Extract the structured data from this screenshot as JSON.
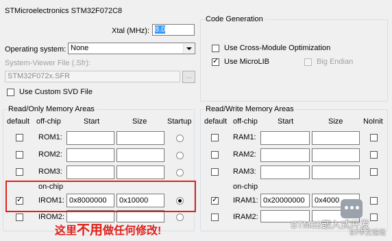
{
  "device": {
    "title": "STMicroelectronics STM32F072C8"
  },
  "xtal": {
    "label": "Xtal (MHz):",
    "value": "8.0"
  },
  "os": {
    "label": "Operating system:",
    "value": "None"
  },
  "sfr": {
    "label": "System-Viewer File (.Sfr):",
    "value": "STM32F072x.SFR",
    "browse": "..."
  },
  "custom_svd": {
    "label": "Use Custom SVD File",
    "checked": false
  },
  "codegen": {
    "title": "Code Generation",
    "cross_module": {
      "label": "Use Cross-Module Optimization",
      "checked": false
    },
    "microlib": {
      "label": "Use MicroLIB",
      "checked": true
    },
    "big_endian": {
      "label": "Big Endian",
      "checked": false,
      "disabled": true
    }
  },
  "rom_area": {
    "title": "Read/Only Memory Areas",
    "headers": {
      "default": "default",
      "offchip": "off-chip",
      "start": "Start",
      "size": "Size",
      "startup": "Startup"
    },
    "onchip_label": "on-chip",
    "rows": [
      {
        "name": "ROM1:",
        "default": false,
        "start": "",
        "size": "",
        "startup": false
      },
      {
        "name": "ROM2:",
        "default": false,
        "start": "",
        "size": "",
        "startup": false
      },
      {
        "name": "ROM3:",
        "default": false,
        "start": "",
        "size": "",
        "startup": false
      },
      {
        "name": "IROM1:",
        "default": true,
        "start": "0x8000000",
        "size": "0x10000",
        "startup": true
      },
      {
        "name": "IROM2:",
        "default": false,
        "start": "",
        "size": "",
        "startup": false
      }
    ]
  },
  "ram_area": {
    "title": "Read/Write Memory Areas",
    "headers": {
      "default": "default",
      "offchip": "off-chip",
      "start": "Start",
      "size": "Size",
      "noinit": "NoInit"
    },
    "onchip_label": "on-chip",
    "rows": [
      {
        "name": "RAM1:",
        "default": false,
        "start": "",
        "size": "",
        "noinit": false
      },
      {
        "name": "RAM2:",
        "default": false,
        "start": "",
        "size": "",
        "noinit": false
      },
      {
        "name": "RAM3:",
        "default": false,
        "start": "",
        "size": "",
        "noinit": false
      },
      {
        "name": "IRAM1:",
        "default": true,
        "start": "0x20000000",
        "size": "0x4000",
        "noinit": false
      },
      {
        "name": "IRAM2:",
        "default": false,
        "start": "",
        "size": "",
        "noinit": false
      }
    ]
  },
  "annotation": {
    "pre": "这里",
    "emph": "不用",
    "post": "做任何修改!"
  },
  "watermark": {
    "text": "STM32嵌入式开发",
    "sub": "ST中文论坛"
  },
  "colors": {
    "highlight": "#e0201a",
    "selection": "#3399ff",
    "group_border": "#d5dfe5"
  }
}
